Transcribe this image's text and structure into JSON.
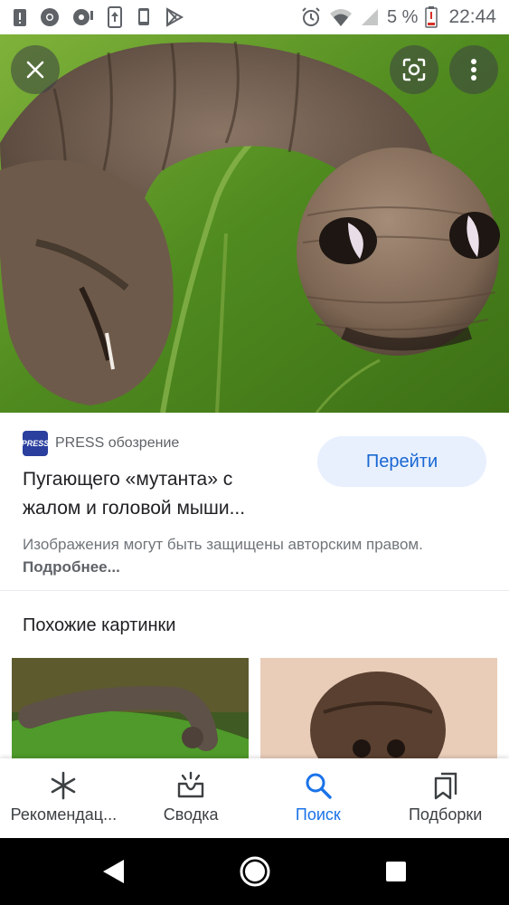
{
  "status_bar": {
    "battery_percent": "5 %",
    "time": "22:44"
  },
  "result": {
    "source_logo_text": "PRESS",
    "source_name": "PRESS обозрение",
    "title": "Пугающего «мутанта» с жалом и головой мыши...",
    "goto_label": "Перейти",
    "copyright_text": "Изображения могут быть защищены авторским правом.",
    "copyright_more": "Подробнее..."
  },
  "similar": {
    "title": "Похожие картинки"
  },
  "bottom_nav": {
    "items": [
      {
        "label": "Рекомендац...",
        "icon": "asterisk-icon",
        "active": false
      },
      {
        "label": "Сводка",
        "icon": "inbox-sparkle-icon",
        "active": false
      },
      {
        "label": "Поиск",
        "icon": "search-icon",
        "active": true
      },
      {
        "label": "Подборки",
        "icon": "collections-icon",
        "active": false
      }
    ]
  },
  "colors": {
    "accent": "#1a73e8",
    "goto_bg": "#e8f0fe",
    "text_primary": "#202124",
    "text_secondary": "#70757a"
  }
}
